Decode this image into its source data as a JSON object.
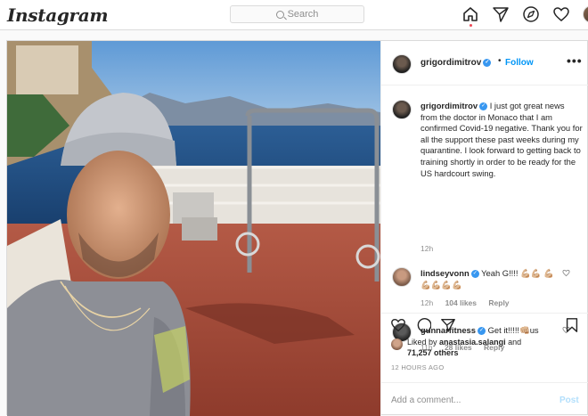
{
  "topbar": {
    "logo": "Instagram",
    "search_placeholder": "Search",
    "nav_icons": [
      "home-icon",
      "direct-icon",
      "explore-icon",
      "activity-heart-icon",
      "profile-avatar"
    ]
  },
  "post": {
    "author": "grigordimitrov",
    "follow_label": "Follow",
    "dot": "•",
    "more": "•••",
    "caption": "I just got great news from the doctor in Monaco that I am confirmed Covid-19 negative. Thank you for all the support these past weeks during my quarantine. I look forward to getting back to training shortly in order to be ready for the US hardcourt swing.",
    "caption_time": "12h",
    "comments": [
      {
        "user": "lindseyvonn",
        "text": "Yeah G!!!! 💪🏼💪🏼 💪🏼💪🏼💪🏼💪🏼💪🏼",
        "time": "12h",
        "likes": "104 likes",
        "reply": "Reply"
      },
      {
        "user": "gunnarfitness",
        "text": "Get it!!!!!👊🏼us",
        "time": "11h",
        "likes": "28 likes",
        "reply": "Reply"
      }
    ],
    "liked_by_prefix": "Liked by",
    "liked_by_user": "anastasia.salangi",
    "liked_by_and": "and",
    "liked_by_others": "71,257 others",
    "timestamp": "12 HOURS AGO",
    "add_comment_placeholder": "Add a comment...",
    "post_button": "Post",
    "colors": {
      "link": "#0095f6",
      "verified": "#3897f0",
      "muted": "#8e8e8e"
    }
  }
}
